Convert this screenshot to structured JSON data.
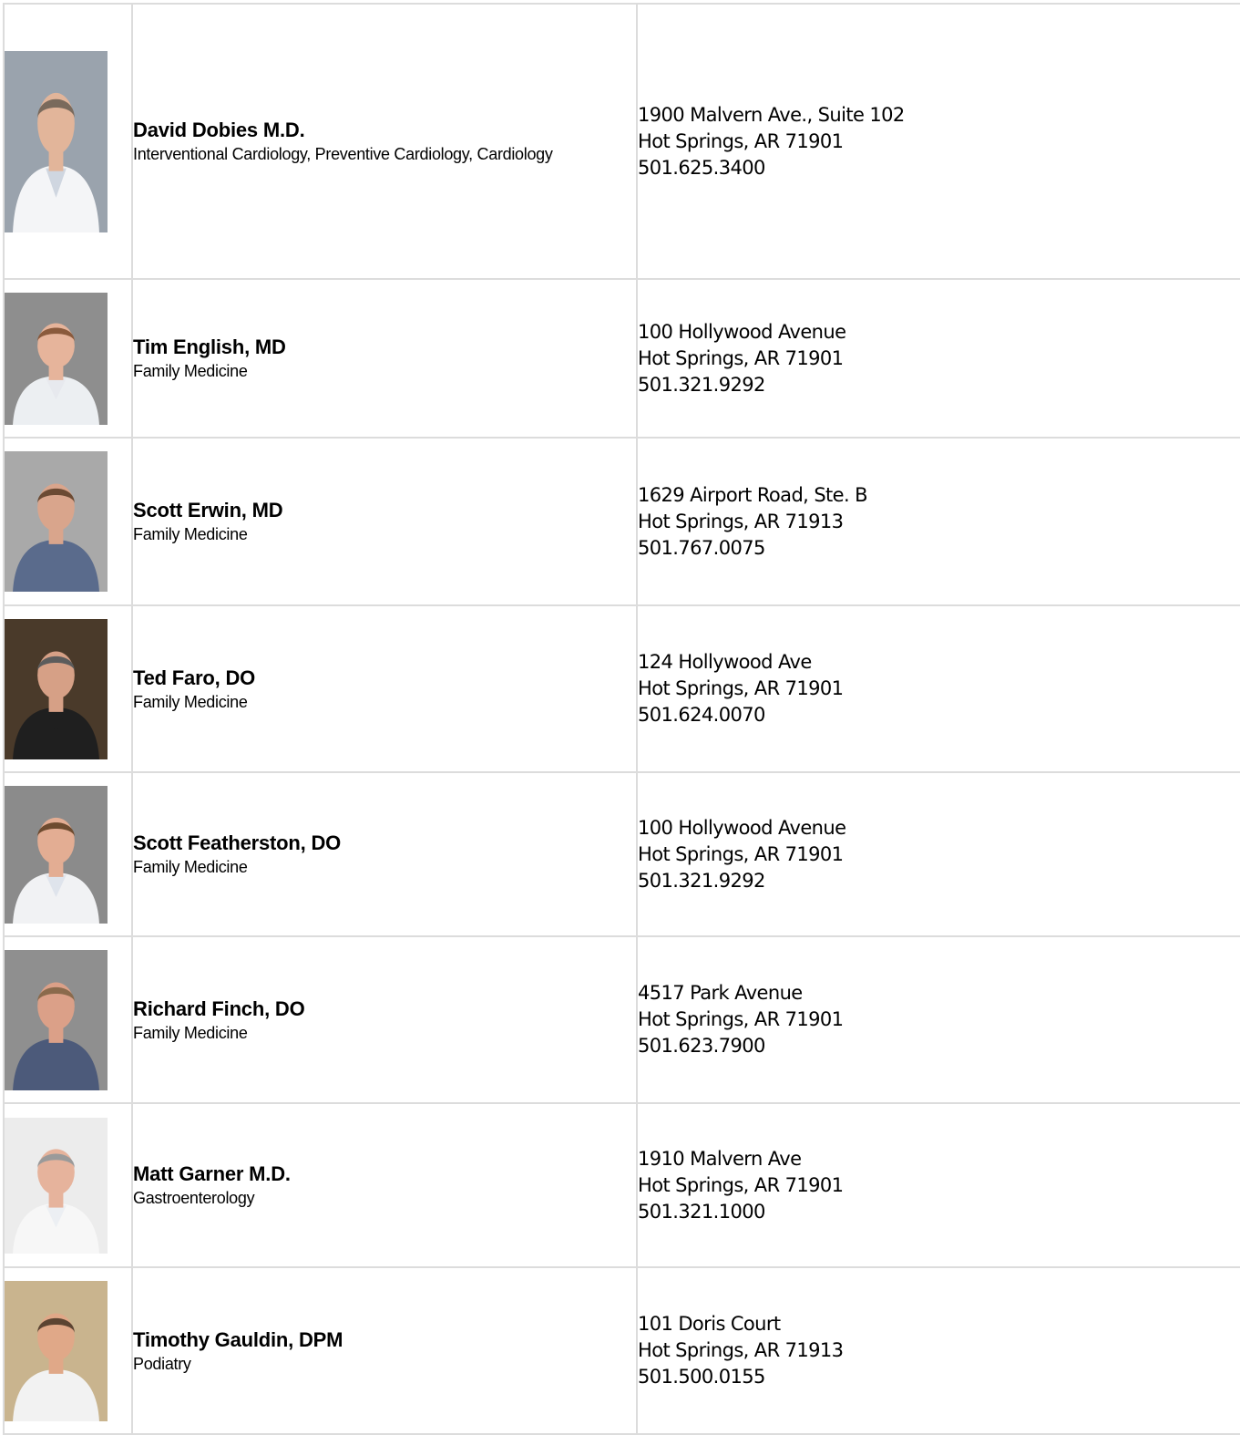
{
  "providers": [
    {
      "name": "David Dobies M.D.",
      "specialty": "Interventional Cardiology, Preventive Cardiology, Cardiology",
      "address_line1": "1900 Malvern Ave., Suite 102",
      "address_line2": "Hot Springs, AR 71901",
      "phone": "501.625.3400",
      "photo_icon": "doctor-portrait-hallway"
    },
    {
      "name": "Tim English, MD",
      "specialty": "Family Medicine",
      "address_line1": "100 Hollywood Avenue",
      "address_line2": "Hot Springs, AR 71901",
      "phone": "501.321.9292",
      "photo_icon": "doctor-portrait-gray"
    },
    {
      "name": "Scott Erwin, MD",
      "specialty": "Family Medicine",
      "address_line1": "1629 Airport Road, Ste. B",
      "address_line2": "Hot Springs, AR 71913",
      "phone": "501.767.0075",
      "photo_icon": "doctor-portrait-gray"
    },
    {
      "name": "Ted Faro, DO",
      "specialty": "Family Medicine",
      "address_line1": "124 Hollywood Ave",
      "address_line2": "Hot Springs, AR 71901",
      "phone": "501.624.0070",
      "photo_icon": "doctor-portrait-dark"
    },
    {
      "name": "Scott Featherston, DO",
      "specialty": "Family Medicine",
      "address_line1": "100 Hollywood Avenue",
      "address_line2": "Hot Springs, AR 71901",
      "phone": "501.321.9292",
      "photo_icon": "doctor-portrait-gray"
    },
    {
      "name": "Richard Finch, DO",
      "specialty": "Family Medicine",
      "address_line1": "4517 Park Avenue",
      "address_line2": "Hot Springs, AR 71901",
      "phone": "501.623.7900",
      "photo_icon": "doctor-portrait-gray"
    },
    {
      "name": "Matt Garner M.D.",
      "specialty": "Gastroenterology",
      "address_line1": "1910 Malvern Ave",
      "address_line2": "Hot Springs, AR 71901",
      "phone": "501.321.1000",
      "photo_icon": "doctor-portrait-light"
    },
    {
      "name": "Timothy Gauldin, DPM",
      "specialty": "Podiatry",
      "address_line1": "101 Doris Court",
      "address_line2": "Hot Springs, AR 71913",
      "phone": "501.500.0155",
      "photo_icon": "doctor-portrait-brick"
    }
  ]
}
